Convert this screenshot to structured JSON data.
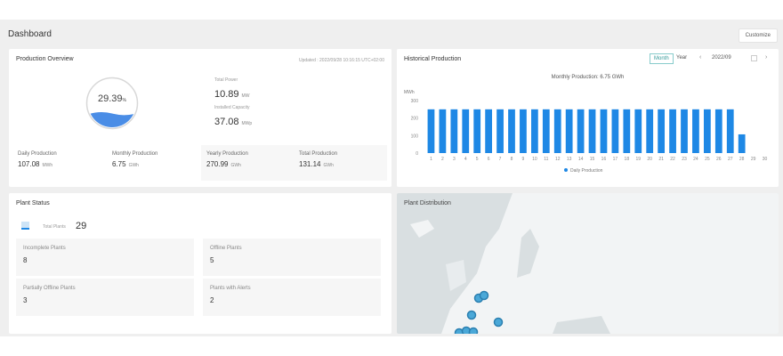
{
  "header": {
    "title": "Dashboard",
    "customize_label": "Customize"
  },
  "overview": {
    "title": "Production Overview",
    "updated": "Updated : 2022/09/28 10:16:15 UTC+02:00",
    "ratio": "29.39",
    "ratio_unit": "%",
    "ratio_fraction": 0.2939,
    "total_power_label": "Total Power",
    "total_power": "10.89",
    "total_power_unit": "MW",
    "capacity_label": "Installed Capacity",
    "capacity": "37.08",
    "capacity_unit": "MWp",
    "stats": [
      {
        "label": "Daily Production",
        "value": "107.08",
        "unit": "MWh"
      },
      {
        "label": "Monthly Production",
        "value": "6.75",
        "unit": "GWh"
      },
      {
        "label": "Yearly Production",
        "value": "270.99",
        "unit": "GWh"
      },
      {
        "label": "Total Production",
        "value": "131.14",
        "unit": "GWh"
      }
    ]
  },
  "historical": {
    "title": "Historical Production",
    "tabs": [
      "Month",
      "Year"
    ],
    "active_tab": "Month",
    "date": "2022/09",
    "summary_label": "Monthly Production:",
    "summary_value": "6.75 GWh"
  },
  "chart_data": {
    "type": "bar",
    "ylabel": "MWh",
    "ylim": [
      0,
      300
    ],
    "yticks": [
      "0",
      "100",
      "200",
      "300"
    ],
    "categories": [
      "1",
      "2",
      "3",
      "4",
      "5",
      "6",
      "7",
      "8",
      "9",
      "10",
      "11",
      "12",
      "13",
      "14",
      "15",
      "16",
      "17",
      "18",
      "19",
      "20",
      "21",
      "22",
      "23",
      "24",
      "25",
      "26",
      "27",
      "28",
      "29",
      "30"
    ],
    "series": [
      {
        "name": "Daily Production",
        "color": "#1e88e5",
        "values": [
          250,
          250,
          250,
          250,
          250,
          250,
          250,
          250,
          250,
          250,
          250,
          250,
          250,
          250,
          250,
          250,
          250,
          250,
          250,
          250,
          250,
          250,
          250,
          250,
          250,
          250,
          250,
          107,
          0,
          0
        ]
      }
    ],
    "legend": "bottom"
  },
  "plant_status": {
    "title": "Plant Status",
    "total_label": "Total Plants",
    "total": "29",
    "items": [
      {
        "label": "Incomplete Plants",
        "value": "8"
      },
      {
        "label": "Offline Plants",
        "value": "5"
      },
      {
        "label": "Partially Offline Plants",
        "value": "3"
      },
      {
        "label": "Plants with Alerts",
        "value": "2"
      }
    ]
  },
  "map": {
    "title": "Plant Distribution",
    "marker_color": "#4aa8d8"
  }
}
